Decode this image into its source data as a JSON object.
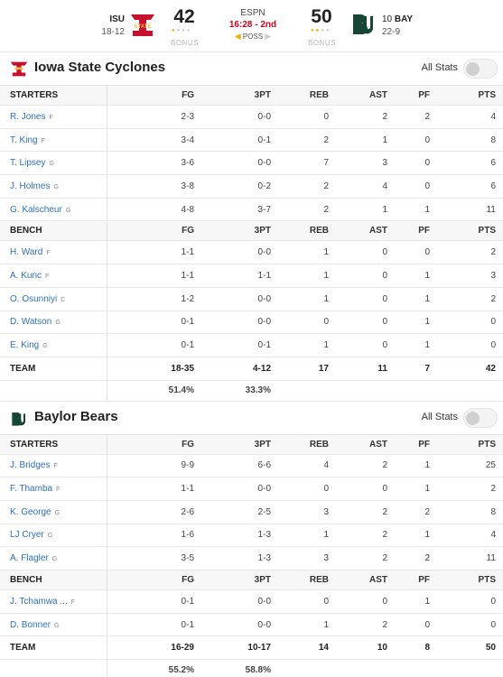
{
  "scoreboard": {
    "away": {
      "abbr": "ISU",
      "record": "18-12",
      "score": "42",
      "bonus": "BONUS"
    },
    "home": {
      "rank": "10",
      "abbr": "BAY",
      "record": "22-9",
      "score": "50",
      "bonus": "BONUS"
    },
    "network": "ESPN",
    "clock": "16:28 - 2nd",
    "poss": "POSS"
  },
  "columns": [
    "FG",
    "3PT",
    "REB",
    "AST",
    "PF",
    "PTS"
  ],
  "isu": {
    "name": "Iowa State Cyclones",
    "all_stats": "All Stats",
    "starters_label": "STARTERS",
    "bench_label": "BENCH",
    "starters": [
      {
        "name": "R. Jones",
        "pos": "F",
        "fg": "2-3",
        "tp": "0-0",
        "reb": "0",
        "ast": "2",
        "pf": "2",
        "pts": "4"
      },
      {
        "name": "T. King",
        "pos": "F",
        "fg": "3-4",
        "tp": "0-1",
        "reb": "2",
        "ast": "1",
        "pf": "0",
        "pts": "8"
      },
      {
        "name": "T. Lipsey",
        "pos": "G",
        "fg": "3-6",
        "tp": "0-0",
        "reb": "7",
        "ast": "3",
        "pf": "0",
        "pts": "6"
      },
      {
        "name": "J. Holmes",
        "pos": "G",
        "fg": "3-8",
        "tp": "0-2",
        "reb": "2",
        "ast": "4",
        "pf": "0",
        "pts": "6"
      },
      {
        "name": "G. Kalscheur",
        "pos": "G",
        "fg": "4-8",
        "tp": "3-7",
        "reb": "2",
        "ast": "1",
        "pf": "1",
        "pts": "11"
      }
    ],
    "bench": [
      {
        "name": "H. Ward",
        "pos": "F",
        "fg": "1-1",
        "tp": "0-0",
        "reb": "1",
        "ast": "0",
        "pf": "0",
        "pts": "2"
      },
      {
        "name": "A. Kunc",
        "pos": "F",
        "fg": "1-1",
        "tp": "1-1",
        "reb": "1",
        "ast": "0",
        "pf": "1",
        "pts": "3"
      },
      {
        "name": "O. Osunniyi",
        "pos": "C",
        "fg": "1-2",
        "tp": "0-0",
        "reb": "1",
        "ast": "0",
        "pf": "1",
        "pts": "2"
      },
      {
        "name": "D. Watson",
        "pos": "G",
        "fg": "0-1",
        "tp": "0-0",
        "reb": "0",
        "ast": "0",
        "pf": "1",
        "pts": "0"
      },
      {
        "name": "E. King",
        "pos": "G",
        "fg": "0-1",
        "tp": "0-1",
        "reb": "1",
        "ast": "0",
        "pf": "1",
        "pts": "0"
      }
    ],
    "totals": {
      "label": "TEAM",
      "fg": "18-35",
      "tp": "4-12",
      "reb": "17",
      "ast": "11",
      "pf": "7",
      "pts": "42"
    },
    "pct": {
      "fg": "51.4%",
      "tp": "33.3%"
    }
  },
  "bay": {
    "name": "Baylor Bears",
    "all_stats": "All Stats",
    "starters_label": "STARTERS",
    "bench_label": "BENCH",
    "starters": [
      {
        "name": "J. Bridges",
        "pos": "F",
        "fg": "9-9",
        "tp": "6-6",
        "reb": "4",
        "ast": "2",
        "pf": "1",
        "pts": "25"
      },
      {
        "name": "F. Thamba",
        "pos": "F",
        "fg": "1-1",
        "tp": "0-0",
        "reb": "0",
        "ast": "0",
        "pf": "1",
        "pts": "2"
      },
      {
        "name": "K. George",
        "pos": "G",
        "fg": "2-6",
        "tp": "2-5",
        "reb": "3",
        "ast": "2",
        "pf": "2",
        "pts": "8"
      },
      {
        "name": "LJ Cryer",
        "pos": "G",
        "fg": "1-6",
        "tp": "1-3",
        "reb": "1",
        "ast": "2",
        "pf": "1",
        "pts": "4"
      },
      {
        "name": "A. Flagler",
        "pos": "G",
        "fg": "3-5",
        "tp": "1-3",
        "reb": "3",
        "ast": "2",
        "pf": "2",
        "pts": "11"
      }
    ],
    "bench": [
      {
        "name": "J. Tchamwa ...",
        "pos": "F",
        "fg": "0-1",
        "tp": "0-0",
        "reb": "0",
        "ast": "0",
        "pf": "1",
        "pts": "0"
      },
      {
        "name": "D. Bonner",
        "pos": "G",
        "fg": "0-1",
        "tp": "0-0",
        "reb": "1",
        "ast": "2",
        "pf": "0",
        "pts": "0"
      }
    ],
    "totals": {
      "label": "TEAM",
      "fg": "16-29",
      "tp": "10-17",
      "reb": "14",
      "ast": "10",
      "pf": "8",
      "pts": "50"
    },
    "pct": {
      "fg": "55.2%",
      "tp": "58.8%"
    }
  },
  "colors": {
    "link": "#2b6fc4",
    "isu_red": "#c8102e",
    "isu_gold": "#f1be48",
    "bay_green": "#154734",
    "clock_red": "#d0021b"
  }
}
